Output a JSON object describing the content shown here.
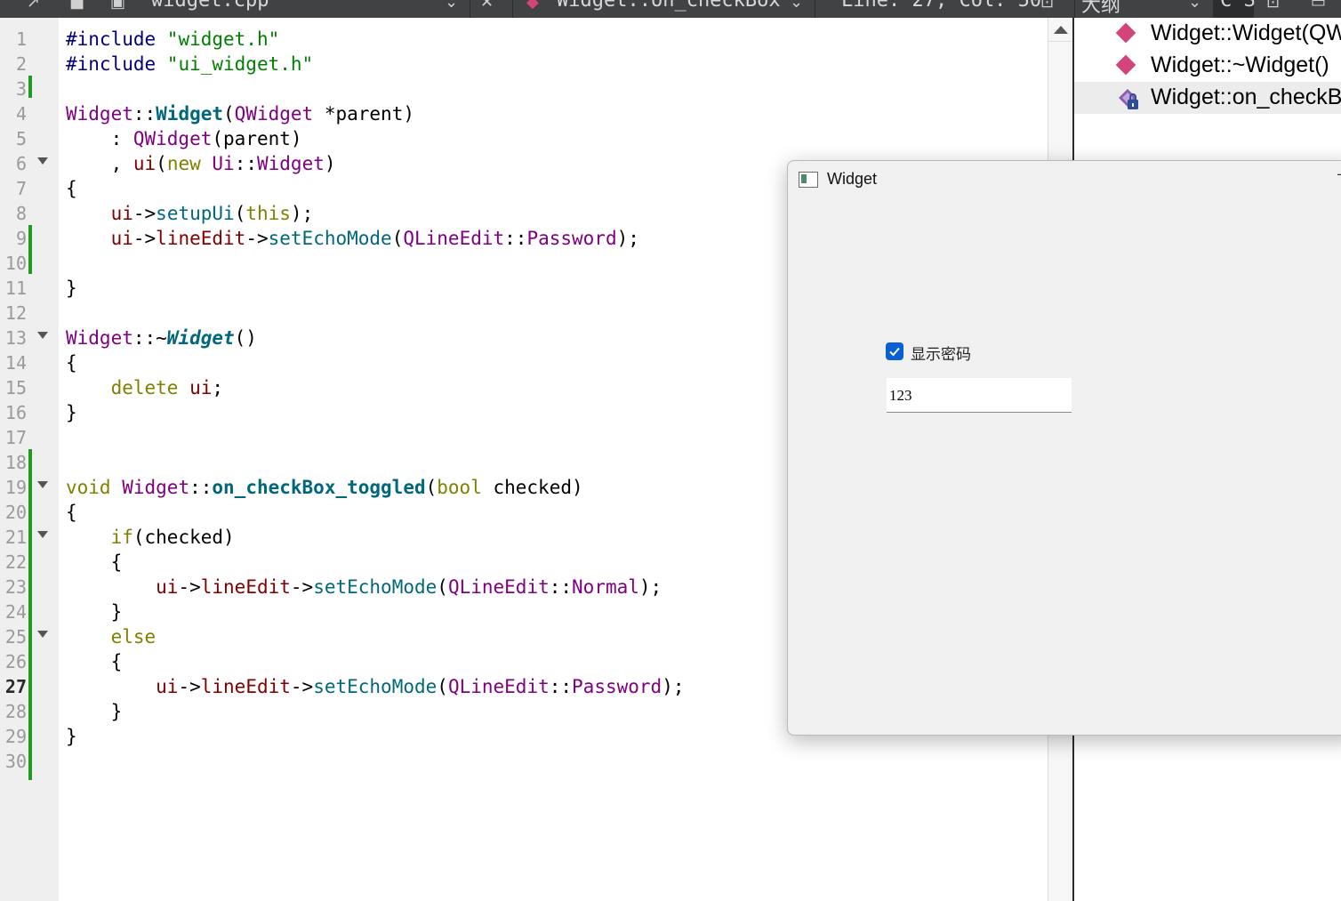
{
  "toolbar": {
    "file_name": "widget.cpp",
    "symbol": "Widget::on_checkBox",
    "position": "Line: 27, Col: 50",
    "panel_title": "大纲",
    "panel_mode": "C S"
  },
  "editor": {
    "current_line": 27,
    "line_numbers": [
      "1",
      "2",
      "3",
      "4",
      "5",
      "6",
      "7",
      "8",
      "9",
      "10",
      "11",
      "12",
      "13",
      "14",
      "15",
      "16",
      "17",
      "18",
      "19",
      "20",
      "21",
      "22",
      "23",
      "24",
      "25",
      "26",
      "27",
      "28",
      "29",
      "30"
    ],
    "code": {
      "l1_a": "#include ",
      "l1_b": "\"widget.h\"",
      "l2_a": "#include ",
      "l2_b": "\"ui_widget.h\"",
      "l4_a": "Widget",
      "l4_b": "::",
      "l4_c": "Widget",
      "l4_d": "(",
      "l4_e": "QWidget",
      "l4_f": " *",
      "l4_g": "parent",
      "l4_h": ")",
      "l5_a": "    : ",
      "l5_b": "QWidget",
      "l5_c": "(",
      "l5_d": "parent",
      "l5_e": ")",
      "l6_a": "    , ",
      "l6_b": "ui",
      "l6_c": "(",
      "l6_d": "new",
      "l6_e": " ",
      "l6_f": "Ui",
      "l6_g": "::",
      "l6_h": "Widget",
      "l6_i": ")",
      "l7": "{",
      "l8_a": "    ",
      "l8_b": "ui",
      "l8_c": "->",
      "l8_d": "setupUi",
      "l8_e": "(",
      "l8_f": "this",
      "l8_g": ");",
      "l9_a": "    ",
      "l9_b": "ui",
      "l9_c": "->",
      "l9_d": "lineEdit",
      "l9_e": "->",
      "l9_f": "setEchoMode",
      "l9_g": "(",
      "l9_h": "QLineEdit",
      "l9_i": "::",
      "l9_j": "Password",
      "l9_k": ");",
      "l11": "}",
      "l13_a": "Widget",
      "l13_b": "::~",
      "l13_c": "Widget",
      "l13_d": "()",
      "l14": "{",
      "l15_a": "    ",
      "l15_b": "delete",
      "l15_c": " ",
      "l15_d": "ui",
      "l15_e": ";",
      "l16": "}",
      "l19_a": "void",
      "l19_b": " ",
      "l19_c": "Widget",
      "l19_d": "::",
      "l19_e": "on_checkBox_toggled",
      "l19_f": "(",
      "l19_g": "bool",
      "l19_h": " checked)",
      "l20": "{",
      "l21_a": "    ",
      "l21_b": "if",
      "l21_c": "(checked)",
      "l22": "    {",
      "l23_a": "        ",
      "l23_b": "ui",
      "l23_c": "->",
      "l23_d": "lineEdit",
      "l23_e": "->",
      "l23_f": "setEchoMode",
      "l23_g": "(",
      "l23_h": "QLineEdit",
      "l23_i": "::",
      "l23_j": "Normal",
      "l23_k": ");",
      "l24": "    }",
      "l25_a": "    ",
      "l25_b": "else",
      "l26": "    {",
      "l27_a": "        ",
      "l27_b": "ui",
      "l27_c": "->",
      "l27_d": "lineEdit",
      "l27_e": "->",
      "l27_f": "setEchoMode",
      "l27_g": "(",
      "l27_h": "QLineEdit",
      "l27_i": "::",
      "l27_j": "Password",
      "l27_k": ");",
      "l28": "    }",
      "l29": "}"
    }
  },
  "outline": {
    "items": [
      {
        "label": "Widget::Widget(QWidget *parent)",
        "icon": "function-icon"
      },
      {
        "label": "Widget::~Widget()",
        "icon": "function-icon"
      },
      {
        "label": "Widget::on_checkBox_toggled(bool checked)",
        "icon": "private-slot-icon"
      }
    ]
  },
  "app_window": {
    "title": "Widget",
    "checkbox_label": "显示密码",
    "checkbox_checked": true,
    "line_edit_value": "123"
  },
  "colors": {
    "keyword": "#808000",
    "type": "#800080",
    "string": "#008000",
    "function": "#00677c",
    "change_marker": "#1f9b1f",
    "checkbox_accent": "#0a5fd3"
  }
}
